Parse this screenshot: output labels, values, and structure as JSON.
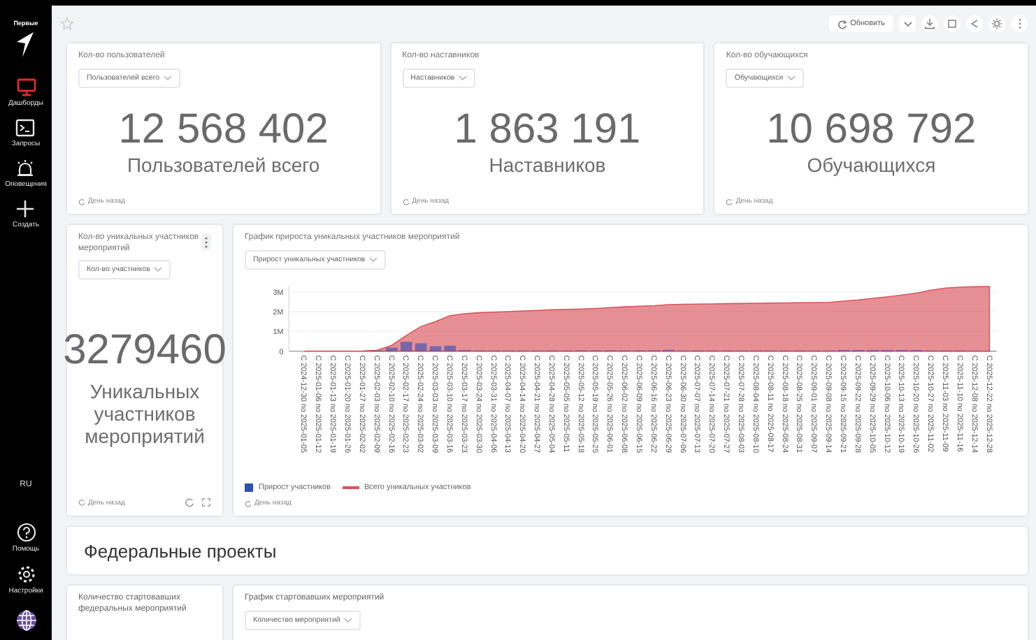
{
  "sidebar": {
    "brand": "Первые",
    "items": [
      {
        "label": "Дашборды",
        "selected": true
      },
      {
        "label": "Запросы",
        "selected": false
      },
      {
        "label": "Оповещения",
        "selected": false
      },
      {
        "label": "Создать",
        "selected": false
      }
    ],
    "language": "RU",
    "bottom_items": [
      {
        "label": "Помощь"
      },
      {
        "label": "Настройки"
      }
    ]
  },
  "toolbar": {
    "refresh": "Обновить"
  },
  "stat_cards": [
    {
      "title": "Кол-во пользователей",
      "filter": "Пользователей всего",
      "value": "12 568 402",
      "caption": "Пользователей всего",
      "updated": "День назад"
    },
    {
      "title": "Кол-во наставников",
      "filter": "Наставников",
      "value": "1 863 191",
      "caption": "Наставников",
      "updated": "День назад"
    },
    {
      "title": "Кол-во обучающихся",
      "filter": "Обучающихся",
      "value": "10 698 792",
      "caption": "Обучающихся",
      "updated": "День назад"
    }
  ],
  "participants_card": {
    "title": "Кол-во уникальных участников мероприятий",
    "filter": "Кол-во участников",
    "value": "3279460",
    "caption": "Уникальных участников мероприятий",
    "updated": "День назад"
  },
  "growth_chart": {
    "title": "График прироста уникальных участников мероприятий",
    "filter": "Прирост уникальных участников",
    "updated": "День назад",
    "chart_data": {
      "type": "bar",
      "grid": true,
      "ylim": [
        0,
        3300000
      ],
      "yticks": [
        {
          "value": 0,
          "label": "0"
        },
        {
          "value": 1000000,
          "label": "1M"
        },
        {
          "value": 2000000,
          "label": "2M"
        },
        {
          "value": 3000000,
          "label": "3M"
        }
      ],
      "categories": [
        "С 2024-12-30 по 2025-01-05",
        "С 2025-01-06 по 2025-01-12",
        "С 2025-01-13 по 2025-01-19",
        "С 2025-01-20 по 2025-01-26",
        "С 2025-01-27 по 2025-02-02",
        "С 2025-02-03 по 2025-02-09",
        "С 2025-02-10 по 2025-02-16",
        "С 2025-02-17 по 2025-02-23",
        "С 2025-02-24 по 2025-03-02",
        "С 2025-03-03 по 2025-03-09",
        "С 2025-03-10 по 2025-03-16",
        "С 2025-03-17 по 2025-03-23",
        "С 2025-03-24 по 2025-03-30",
        "С 2025-03-31 по 2025-04-06",
        "С 2025-04-07 по 2025-04-13",
        "С 2025-04-14 по 2025-04-20",
        "С 2025-04-21 по 2025-04-27",
        "С 2025-04-28 по 2025-05-04",
        "С 2025-05-05 по 2025-05-11",
        "С 2025-05-12 по 2025-05-18",
        "С 2025-05-19 по 2025-05-25",
        "С 2025-05-26 по 2025-06-01",
        "С 2025-06-02 по 2025-06-08",
        "С 2025-06-09 по 2025-06-15",
        "С 2025-06-16 по 2025-06-22",
        "С 2025-06-23 по 2025-06-29",
        "С 2025-06-30 по 2025-07-06",
        "С 2025-07-07 по 2025-07-13",
        "С 2025-07-14 по 2025-07-20",
        "С 2025-07-21 по 2025-07-27",
        "С 2025-07-28 по 2025-08-03",
        "С 2025-08-04 по 2025-08-10",
        "С 2025-08-11 по 2025-08-17",
        "С 2025-08-18 по 2025-08-24",
        "С 2025-08-25 по 2025-08-31",
        "С 2025-09-01 по 2025-09-07",
        "С 2025-09-08 по 2025-09-14",
        "С 2025-09-15 по 2025-09-21",
        "С 2025-09-22 по 2025-09-28",
        "С 2025-09-29 по 2025-10-05",
        "С 2025-10-06 по 2025-10-12",
        "С 2025-10-13 по 2025-10-19",
        "С 2025-10-20 по 2025-10-26",
        "С 2025-10-27 по 2025-11-02",
        "С 2025-11-03 по 2025-11-09",
        "С 2025-11-10 по 2025-11-16",
        "С 2025-12-08 по 2025-12-14",
        "С 2025-12-22 по 2025-12-28"
      ],
      "series": [
        {
          "name": "Прирост участников",
          "color": "#2f4fb8",
          "values": [
            0,
            0,
            0,
            0,
            0,
            30000,
            180000,
            480000,
            400000,
            250000,
            280000,
            60000,
            30000,
            30000,
            30000,
            30000,
            30000,
            30000,
            30000,
            40000,
            40000,
            40000,
            40000,
            40000,
            40000,
            70000,
            30000,
            30000,
            30000,
            30000,
            30000,
            30000,
            30000,
            30000,
            30000,
            30000,
            30000,
            60000,
            60000,
            60000,
            60000,
            60000,
            60000,
            30000,
            30000,
            30000,
            20000,
            20000
          ]
        },
        {
          "name": "Всего уникальных участников",
          "type": "area",
          "color": "#d9545c",
          "values": [
            0,
            0,
            0,
            0,
            10000,
            50000,
            300000,
            800000,
            1250000,
            1500000,
            1800000,
            1900000,
            1950000,
            1980000,
            2010000,
            2040000,
            2070000,
            2100000,
            2120000,
            2140000,
            2170000,
            2210000,
            2250000,
            2280000,
            2310000,
            2360000,
            2380000,
            2390000,
            2400000,
            2410000,
            2420000,
            2430000,
            2440000,
            2450000,
            2460000,
            2470000,
            2480000,
            2540000,
            2600000,
            2680000,
            2760000,
            2850000,
            2950000,
            3100000,
            3200000,
            3250000,
            3270000,
            3280000
          ]
        }
      ]
    }
  },
  "section_title": "Федеральные проекты",
  "federal_card": {
    "title": "Количество стартовавших федеральных мероприятий"
  },
  "events_chart": {
    "title": "График стартовавших мероприятий",
    "filter": "Количество мероприятий"
  }
}
